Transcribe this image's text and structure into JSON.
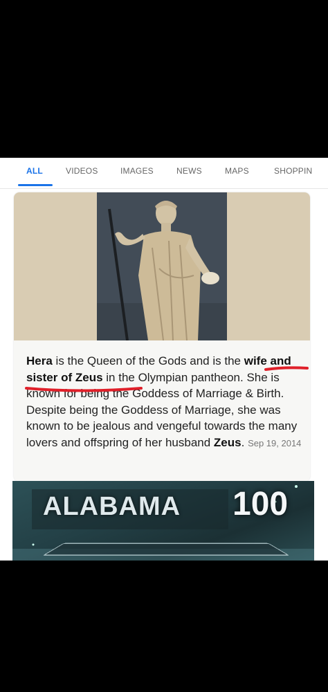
{
  "tabs": [
    {
      "label": "ALL",
      "active": true
    },
    {
      "label": "VIDEOS",
      "active": false
    },
    {
      "label": "IMAGES",
      "active": false
    },
    {
      "label": "NEWS",
      "active": false
    },
    {
      "label": "MAPS",
      "active": false
    },
    {
      "label": "SHOPPIN",
      "active": false
    }
  ],
  "result": {
    "image_icon": "statue-of-hera-image",
    "snippet": {
      "part1_bold": "Hera",
      "part2": " is the Queen of the Gods and is the ",
      "part3_bold": "wife and sister of Zeus",
      "part4": " in the Olympian pantheon. She is known for being the Goddess of Marriage & Birth. Despite being the Goddess of Marriage, she was known to be jealous and vengeful towards the many lovers and offspring of her husband ",
      "part5_bold": "Zeus",
      "part6": ". "
    },
    "date": "Sep 19, 2014"
  },
  "meme": {
    "text": "ALABAMA",
    "score": "100"
  },
  "colors": {
    "accent": "#1a73e8",
    "underline": "#e0202a"
  }
}
